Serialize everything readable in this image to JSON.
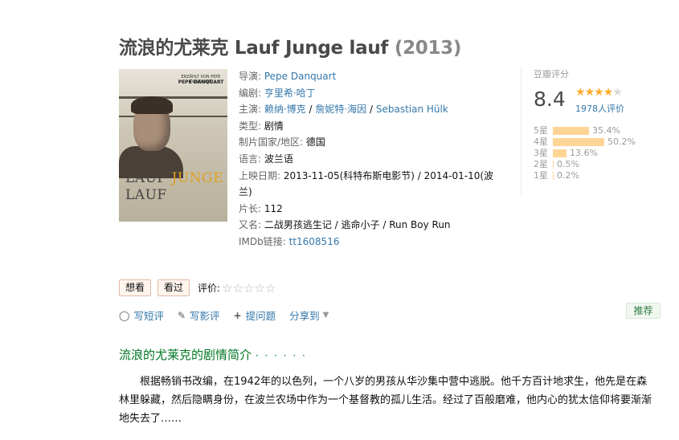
{
  "header": {
    "title": "流浪的尤莱克 Lauf Junge lauf",
    "year": "(2013)"
  },
  "poster": {
    "top_text": "ERZÄHLT VON PEPE DANQUART",
    "director": "PEPE DANQUART",
    "title_line1_a": "LAUF ",
    "title_line1_b": "JUNGE",
    "title_line2": "LAUF"
  },
  "info": {
    "director_label": "导演: ",
    "director": "Pepe Danquart",
    "writer_label": "编剧: ",
    "writer": "亨里希·哈丁",
    "cast_label": "主演: ",
    "cast1": "赖纳·博克",
    "cast2": "詹妮特·海因",
    "cast3": "Sebastian Hülk",
    "sep": " / ",
    "genre_label": "类型: ",
    "genre": "剧情",
    "country_label": "制片国家/地区: ",
    "country": "德国",
    "language_label": "语言: ",
    "language": "波兰语",
    "release_label": "上映日期: ",
    "release": "2013-11-05(科特布斯电影节) / 2014-01-10(波兰)",
    "runtime_label": "片长: ",
    "runtime": "112",
    "aka_label": "又名: ",
    "aka": "二战男孩逃生记 / 逃命小子 / Run Boy Run",
    "imdb_label": "IMDb链接: ",
    "imdb": "tt1608516"
  },
  "rating": {
    "label": "豆瓣评分",
    "score": "8.4",
    "stars_filled": 4,
    "count": "1978人评价",
    "distribution": [
      {
        "label": "5星",
        "pct": "35.4%",
        "value": 35.4
      },
      {
        "label": "4星",
        "pct": "50.2%",
        "value": 50.2
      },
      {
        "label": "3星",
        "pct": "13.6%",
        "value": 13.6
      },
      {
        "label": "2星",
        "pct": "0.5%",
        "value": 0.5
      },
      {
        "label": "1星",
        "pct": "0.2%",
        "value": 0.2
      }
    ]
  },
  "actions": {
    "want": "想看",
    "seen": "看过",
    "rate_label": "评价:",
    "empty_stars": "☆☆☆☆☆"
  },
  "links": {
    "short_review": "写短评",
    "review": "写影评",
    "question": "提问题",
    "share": "分享到",
    "recommend": "推荐"
  },
  "summary": {
    "title": "流浪的尤莱克的剧情简介",
    "dots": "· · · · · ·",
    "text": "根据畅销书改编，在1942年的以色列，一个八岁的男孩从华沙集中营中逃脱。他千方百计地求生，他先是在森林里躲藏，然后隐瞒身份，在波兰农场中作为一个基督教的孤儿生活。经过了百般磨难，他内心的犹太信仰将要渐渐地失去了……"
  },
  "colors": {
    "link": "#3377aa",
    "star": "#ffac2d",
    "bar": "#ffd596",
    "section_green": "#007722"
  }
}
